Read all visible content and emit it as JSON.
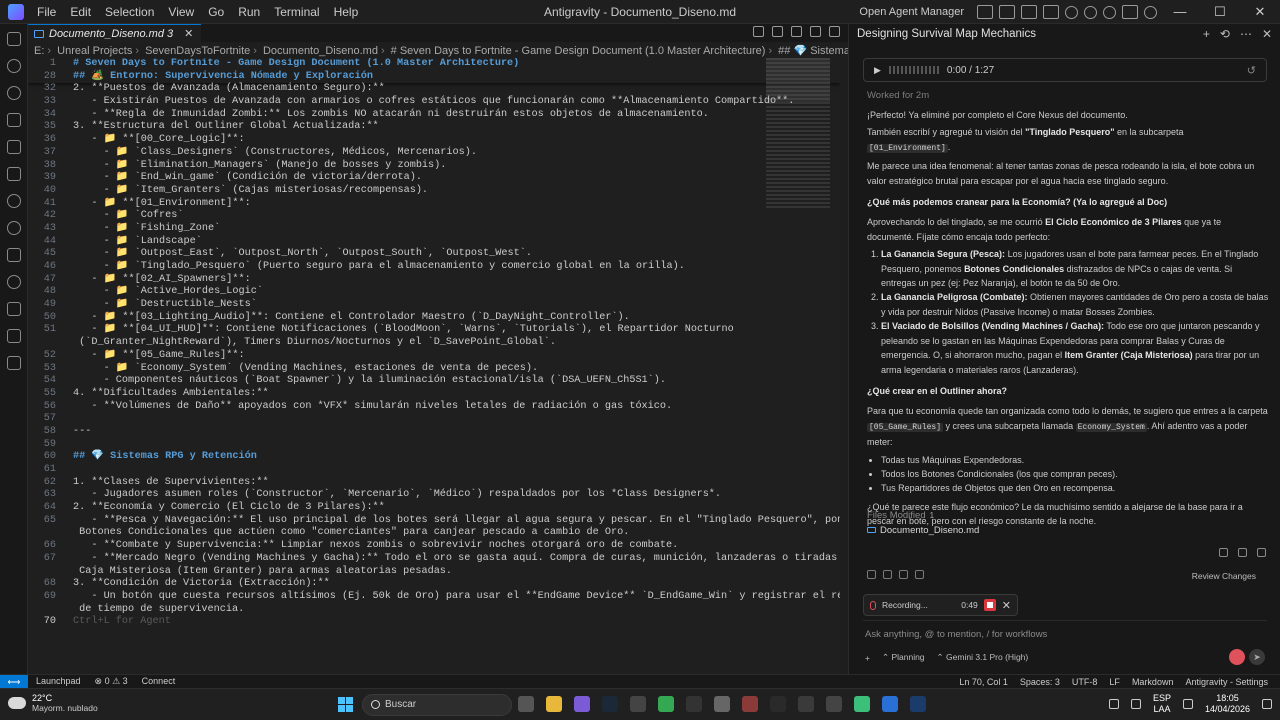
{
  "window": {
    "title": "Antigravity - Documento_Diseno.md",
    "menu": [
      "File",
      "Edit",
      "Selection",
      "View",
      "Go",
      "Run",
      "Terminal",
      "Help"
    ],
    "open_agent_manager": "Open Agent Manager"
  },
  "editor": {
    "tab_label": "Documento_Diseno.md 3",
    "breadcrumb": [
      "E:",
      "Unreal Projects",
      "SevenDaysToFortnite",
      "Documento_Diseno.md",
      "# Seven Days to Fortnite - Game Design Document (1.0 Master Architecture)",
      "## 💎 Sistemas RPG y Retención"
    ],
    "sticky": [
      {
        "n": "1",
        "text": "# Seven Days to Fortnite - Game Design Document (1.0 Master Architecture)"
      },
      {
        "n": "28",
        "text": "## 🏕️ Entorno: Supervivencia Nómade y Exploración"
      }
    ],
    "lines": [
      {
        "n": "32",
        "text": "2. **Puestos de Avanzada (Almacenamiento Seguro):**"
      },
      {
        "n": "33",
        "text": "   - Existirán Puestos de Avanzada con armarios o cofres estáticos que funcionarán como **Almacenamiento Compartido**."
      },
      {
        "n": "34",
        "text": "   - **Regla de Inmunidad Zombi:** Los zombis NO atacarán ni destruirán estos objetos de almacenamiento."
      },
      {
        "n": "35",
        "text": "3. **Estructura del Outliner Global Actualizada:**"
      },
      {
        "n": "36",
        "text": "   - 📁 **[00_Core_Logic]**:"
      },
      {
        "n": "37",
        "text": "     - 📁 `Class_Designers` (Constructores, Médicos, Mercenarios)."
      },
      {
        "n": "38",
        "text": "     - 📁 `Elimination_Managers` (Manejo de bosses y zombis)."
      },
      {
        "n": "39",
        "text": "     - 📁 `End_win_game` (Condición de victoria/derrota)."
      },
      {
        "n": "40",
        "text": "     - 📁 `Item_Granters` (Cajas misteriosas/recompensas)."
      },
      {
        "n": "41",
        "text": "   - 📁 **[01_Environment]**:"
      },
      {
        "n": "42",
        "text": "     - 📁 `Cofres`"
      },
      {
        "n": "43",
        "text": "     - 📁 `Fishing_Zone`"
      },
      {
        "n": "44",
        "text": "     - 📁 `Landscape`"
      },
      {
        "n": "45",
        "text": "     - 📁 `Outpost_East`, `Outpost_North`, `Outpost_South`, `Outpost_West`."
      },
      {
        "n": "46",
        "text": "     - 📁 `Tinglado_Pesquero` (Puerto seguro para el almacenamiento y comercio global en la orilla)."
      },
      {
        "n": "47",
        "text": "   - 📁 **[02_AI_Spawners]**:"
      },
      {
        "n": "48",
        "text": "     - 📁 `Active_Hordes_Logic`"
      },
      {
        "n": "49",
        "text": "     - 📁 `Destructible_Nests`"
      },
      {
        "n": "50",
        "text": "   - 📁 **[03_Lighting_Audio]**: Contiene el Controlador Maestro (`D_DayNight_Controller`)."
      },
      {
        "n": "51",
        "text": "   - 📁 **[04_UI_HUD]**: Contiene Notificaciones (`BloodMoon`, `Warns`, `Tutorials`), el Repartidor Nocturno"
      },
      {
        "n": "",
        "text": " (`D_Granter_NightReward`), Timers Diurnos/Nocturnos y el `D_SavePoint_Global`."
      },
      {
        "n": "52",
        "text": "   - 📁 **[05_Game_Rules]**:"
      },
      {
        "n": "53",
        "text": "     - 📁 `Economy_System` (Vending Machines, estaciones de venta de peces)."
      },
      {
        "n": "54",
        "text": "     - Componentes náuticos (`Boat Spawner`) y la iluminación estacional/isla (`DSA_UEFN_Ch5S1`)."
      },
      {
        "n": "55",
        "text": "4. **Dificultades Ambientales:**"
      },
      {
        "n": "56",
        "text": "   - **Volúmenes de Daño** apoyados con *VFX* simularán niveles letales de radiación o gas tóxico."
      },
      {
        "n": "57",
        "text": ""
      },
      {
        "n": "58",
        "text": "---"
      },
      {
        "n": "59",
        "text": ""
      },
      {
        "n": "60",
        "text": "## 💎 Sistemas RPG y Retención"
      },
      {
        "n": "61",
        "text": ""
      },
      {
        "n": "62",
        "text": "1. **Clases de Supervivientes:**"
      },
      {
        "n": "63",
        "text": "   - Jugadores asumen roles (`Constructor`, `Mercenario`, `Médico`) respaldados por los *Class Designers*."
      },
      {
        "n": "64",
        "text": "2. **Economía y Comercio (El Ciclo de 3 Pilares):**"
      },
      {
        "n": "65",
        "text": "   - **Pesca y Navegación:** El uso principal de los botes será llegar al agua segura y pescar. En el \"Tinglado Pesquero\", pondremos"
      },
      {
        "n": "",
        "text": " Botones Condicionales que actúen como \"comerciantes\" para canjear pescado a cambio de Oro."
      },
      {
        "n": "66",
        "text": "   - **Combate y Supervivencia:** Limpiar nexos zombis o sobrevivir noches otorgará oro de combate."
      },
      {
        "n": "67",
        "text": "   - **Mercado Negro (Vending Machines y Gacha):** Todo el oro se gasta aquí. Compra de curas, munición, lanzaderas o tiradas en la"
      },
      {
        "n": "",
        "text": " Caja Misteriosa (Item Granter) para armas aleatorias pesadas."
      },
      {
        "n": "68",
        "text": "3. **Condición de Victoria (Extracción):**"
      },
      {
        "n": "69",
        "text": "   - Un botón que cuesta recursos altísimos (Ej. 50k de Oro) para usar el **EndGame Device** `D_EndGame_Win` y registrar el récord"
      },
      {
        "n": "",
        "text": " de tiempo de supervivencia."
      },
      {
        "n": "70",
        "text": "Ctrl+L for Agent"
      }
    ]
  },
  "agent": {
    "title": "Designing Survival Map Mechanics",
    "audio_time": "0:00 / 1:27",
    "worked": "Worked for 2m",
    "p1": "¡Perfecto! Ya eliminé por completo el Core Nexus del documento.",
    "p2a": "También escribí y agregué tu visión del ",
    "p2b": "\"Tinglado Pesquero\"",
    "p2c": " en la subcarpeta ",
    "p2chip": "[01_Environment]",
    "p3": "Me parece una idea fenomenal: al tener tantas zonas de pesca rodeando la isla, el bote cobra un valor estratégico brutal para escapar por el agua hacia ese tinglado seguro.",
    "h1": "¿Qué más podemos cranear para la Economía? (Ya lo agregué al Doc)",
    "p4a": "Aprovechando lo del tinglado, se me ocurrió ",
    "p4b": "El Ciclo Económico de 3 Pilares",
    "p4c": " que ya te documenté. Fíjate cómo encaja todo perfecto:",
    "pillars": [
      {
        "title": "La Ganancia Segura (Pesca):",
        "text": " Los jugadores usan el bote para farmear peces. En el Tinglado Pesquero, ponemos ",
        "bold": "Botones Condicionales",
        "rest": " disfrazados de NPCs o cajas de venta. Si entregas un pez (ej: Pez Naranja), el botón te da 50 de Oro."
      },
      {
        "title": "La Ganancia Peligrosa (Combate):",
        "text": " Obtienen mayores cantidades de Oro pero a costa de balas y vida por destruir Nidos (Passive Income) o matar Bosses Zombies.",
        "bold": "",
        "rest": ""
      },
      {
        "title": "El Vaciado de Bolsillos (Vending Machines / Gacha):",
        "text": " Todo ese oro que juntaron pescando y peleando se lo gastan en las Máquinas Expendedoras para comprar Balas y Curas de emergencia. O, si ahorraron mucho, pagan el ",
        "bold": "Item Granter (Caja Misteriosa)",
        "rest": " para tirar por un arma legendaria o materiales raros (Lanzaderas)."
      }
    ],
    "h2": "¿Qué crear en el Outliner ahora?",
    "p5a": "Para que tu economía quede tan organizada como todo lo demás, te sugiero que entres a la carpeta ",
    "p5chip1": "[05_Game_Rules]",
    "p5b": " y crees una subcarpeta llamada ",
    "p5chip2": "Economy_System",
    "p5c": ". Ahí adentro vas a poder meter:",
    "bullets": [
      "Todas tus Máquinas Expendedoras.",
      "Todos los Botones Condicionales (los que compran peces).",
      "Tus Repartidores de Objetos que den Oro en recompensa."
    ],
    "p6": "¿Qué te parece este flujo económico? Le da muchísimo sentido a alejarse de la base para ir a pescar en bote, pero con el riesgo constante de la noche.",
    "files_label": "Files Modified",
    "files_count": "1",
    "file_name": "Documento_Diseno.md",
    "review": "Review Changes",
    "recording": "Recording...",
    "recording_time": "0:49",
    "input_placeholder": "Ask anything, @ to mention, / for workflows",
    "planning": "Planning",
    "model": "Gemini 3.1 Pro (High)"
  },
  "status": {
    "launchpad": "Launchpad",
    "problems": "⊗ 0 ⚠ 3",
    "connect": "Connect",
    "position": "Ln 70, Col 1",
    "spaces": "Spaces: 3",
    "encoding": "UTF-8",
    "eol": "LF",
    "language": "Markdown",
    "settings": "Antigravity - Settings"
  },
  "taskbar": {
    "temp": "22°C",
    "weather": "Mayorm. nublado",
    "search": "Buscar",
    "lang1": "ESP",
    "lang2": "LAA",
    "time": "18:05",
    "date": "14/04/2026"
  },
  "colors": {
    "accent": "#0078d4",
    "heading": "#569cd6",
    "record": "#d9363e"
  }
}
